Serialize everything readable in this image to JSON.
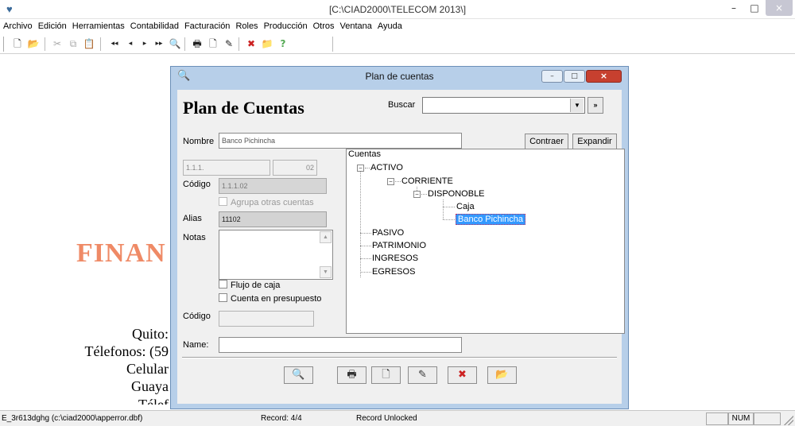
{
  "window": {
    "title": "[C:\\CIAD2000\\TELECOM 2013\\]",
    "min_glyph": "–",
    "max_glyph": "□",
    "close_glyph": "×",
    "app_glyph": "♥"
  },
  "menu": [
    "Archivo",
    "Edición",
    "Herramientas",
    "Contabilidad",
    "Facturación",
    "Roles",
    "Producción",
    "Otros",
    "Ventana",
    "Ayuda"
  ],
  "toolbar": {
    "new": "🗋",
    "open": "📂",
    "cut": "✂",
    "copy": "⧉",
    "paste": "📋",
    "first": "◂◂",
    "prev": "◂",
    "next": "▸",
    "last": "▸▸",
    "find": "🔍",
    "print": "🖶",
    "new2": "🗋",
    "edit": "✎",
    "delete": "✖",
    "folder": "📁",
    "help": "?"
  },
  "background": {
    "finan": "FINAN",
    "line1": "Quito:",
    "line2": "Télefonos: (59",
    "line3": "Celular",
    "line4": "Guaya",
    "line5": "Télef"
  },
  "status": {
    "file": "E_3r613dghg (c:\\ciad2000\\apperror.dbf)",
    "record": "Record: 4/4",
    "lock": "Record Unlocked",
    "num": "NUM"
  },
  "dialog": {
    "title": "Plan de cuentas",
    "heading": "Plan de Cuentas",
    "buscar_label": "Buscar",
    "buscar_value": "",
    "search_go": "»",
    "nombre_label": "Nombre",
    "nombre_value": "Banco Pichincha",
    "contraer": "Contraer",
    "expandir": "Expandir",
    "parent_code": "1.1.1.",
    "sub_code": "02",
    "codigo_label": "Código",
    "codigo_value": "1.1.1.02",
    "agrupa_label": "Agrupa otras cuentas",
    "alias_label": "Alias",
    "alias_value": "11102",
    "notas_label": "Notas",
    "flujo_label": "Flujo de caja",
    "presupuesto_label": "Cuenta en presupuesto",
    "codigo2_label": "Código",
    "codigo2_value": "",
    "name_label": "Name:",
    "name_value": ""
  },
  "tree": {
    "root": "Cuentas",
    "activo": "ACTIVO",
    "corriente": "CORRIENTE",
    "disponible": "DISPONOBLE",
    "caja": "Caja",
    "banco": "Banco Pichincha",
    "pasivo": "PASIVO",
    "patrimonio": "PATRIMONIO",
    "ingresos": "INGRESOS",
    "egresos": "EGRESOS",
    "selected": "Banco Pichincha"
  },
  "actions": {
    "find": "🔍",
    "print": "🖶",
    "new": "🗋",
    "edit": "✎",
    "delete": "✖",
    "open": "📂"
  },
  "colors": {
    "accent": "#3399ff",
    "dialog_frame": "#b7cfe9",
    "finan_text": "#ef8a66",
    "close_button": "#c7402f"
  }
}
